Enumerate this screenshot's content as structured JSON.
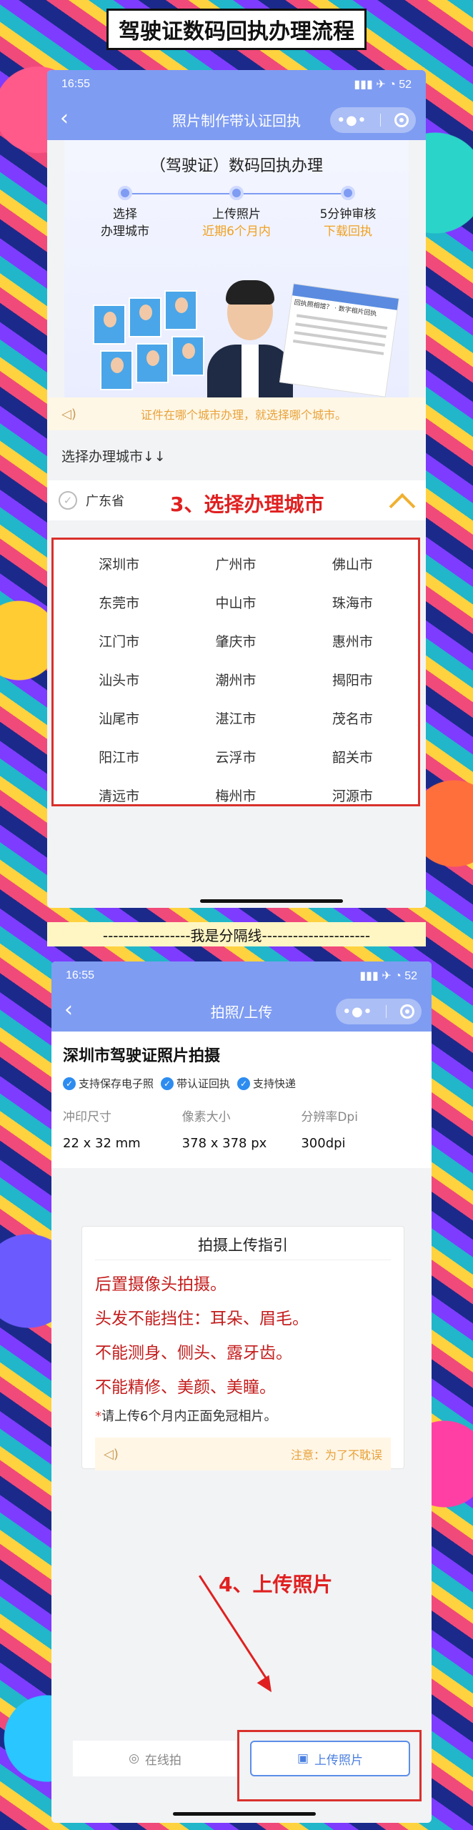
{
  "header_title": "驾驶证数码回执办理流程",
  "phone1": {
    "status": {
      "time": "16:55",
      "battery": "52"
    },
    "nav_title": "照片制作带认证回执",
    "banner_title": "（驾驶证）数码回执办理",
    "steps": [
      {
        "label": "选择",
        "label2": "办理城市",
        "sub": ""
      },
      {
        "label": "上传照片",
        "label2": "",
        "sub": "近期6个月内"
      },
      {
        "label": "5分钟审核",
        "label2": "",
        "sub": "下载回执"
      }
    ],
    "receipt_title": "回执照相馆？ · 数字相片回执",
    "notice": "证件在哪个城市办理，就选择哪个城市。",
    "city_section_label": "选择办理城市↓↓",
    "province": "广东省",
    "callout": "3、选择办理城市",
    "cities": [
      "深圳市",
      "广州市",
      "佛山市",
      "东莞市",
      "中山市",
      "珠海市",
      "江门市",
      "肇庆市",
      "惠州市",
      "汕头市",
      "潮州市",
      "揭阳市",
      "汕尾市",
      "湛江市",
      "茂名市",
      "阳江市",
      "云浮市",
      "韶关市",
      "清远市",
      "梅州市",
      "河源市"
    ]
  },
  "divider_text": "-----------------我是分隔线---------------------",
  "phone2": {
    "status": {
      "time": "16:55",
      "battery": "52"
    },
    "nav_title": "拍照/上传",
    "shop_title": "深圳市驾驶证照片拍摄",
    "tags": [
      "支持保存电子照",
      "带认证回执",
      "支持快递"
    ],
    "specs": [
      {
        "label": "冲印尺寸",
        "value": "22 x 32 mm"
      },
      {
        "label": "像素大小",
        "value": "378 x 378 px"
      },
      {
        "label": "分辨率Dpi",
        "value": "300dpi"
      }
    ],
    "guide_title": "拍摄上传指引",
    "rules": [
      "后置摄像头拍摄。",
      "头发不能挡住：耳朵、眉毛。",
      "不能测身、侧头、露牙齿。",
      "不能精修、美颜、美瞳。"
    ],
    "note": "请上传6个月内正面免冠相片。",
    "guide_notice": "注意：为了不耽误",
    "callout": "4、上传照片",
    "btn_online": "在线拍",
    "btn_upload": "上传照片"
  },
  "colors": {
    "nav": "#7e9cf2",
    "callout": "#e02020",
    "notice": "#e8a23a"
  }
}
